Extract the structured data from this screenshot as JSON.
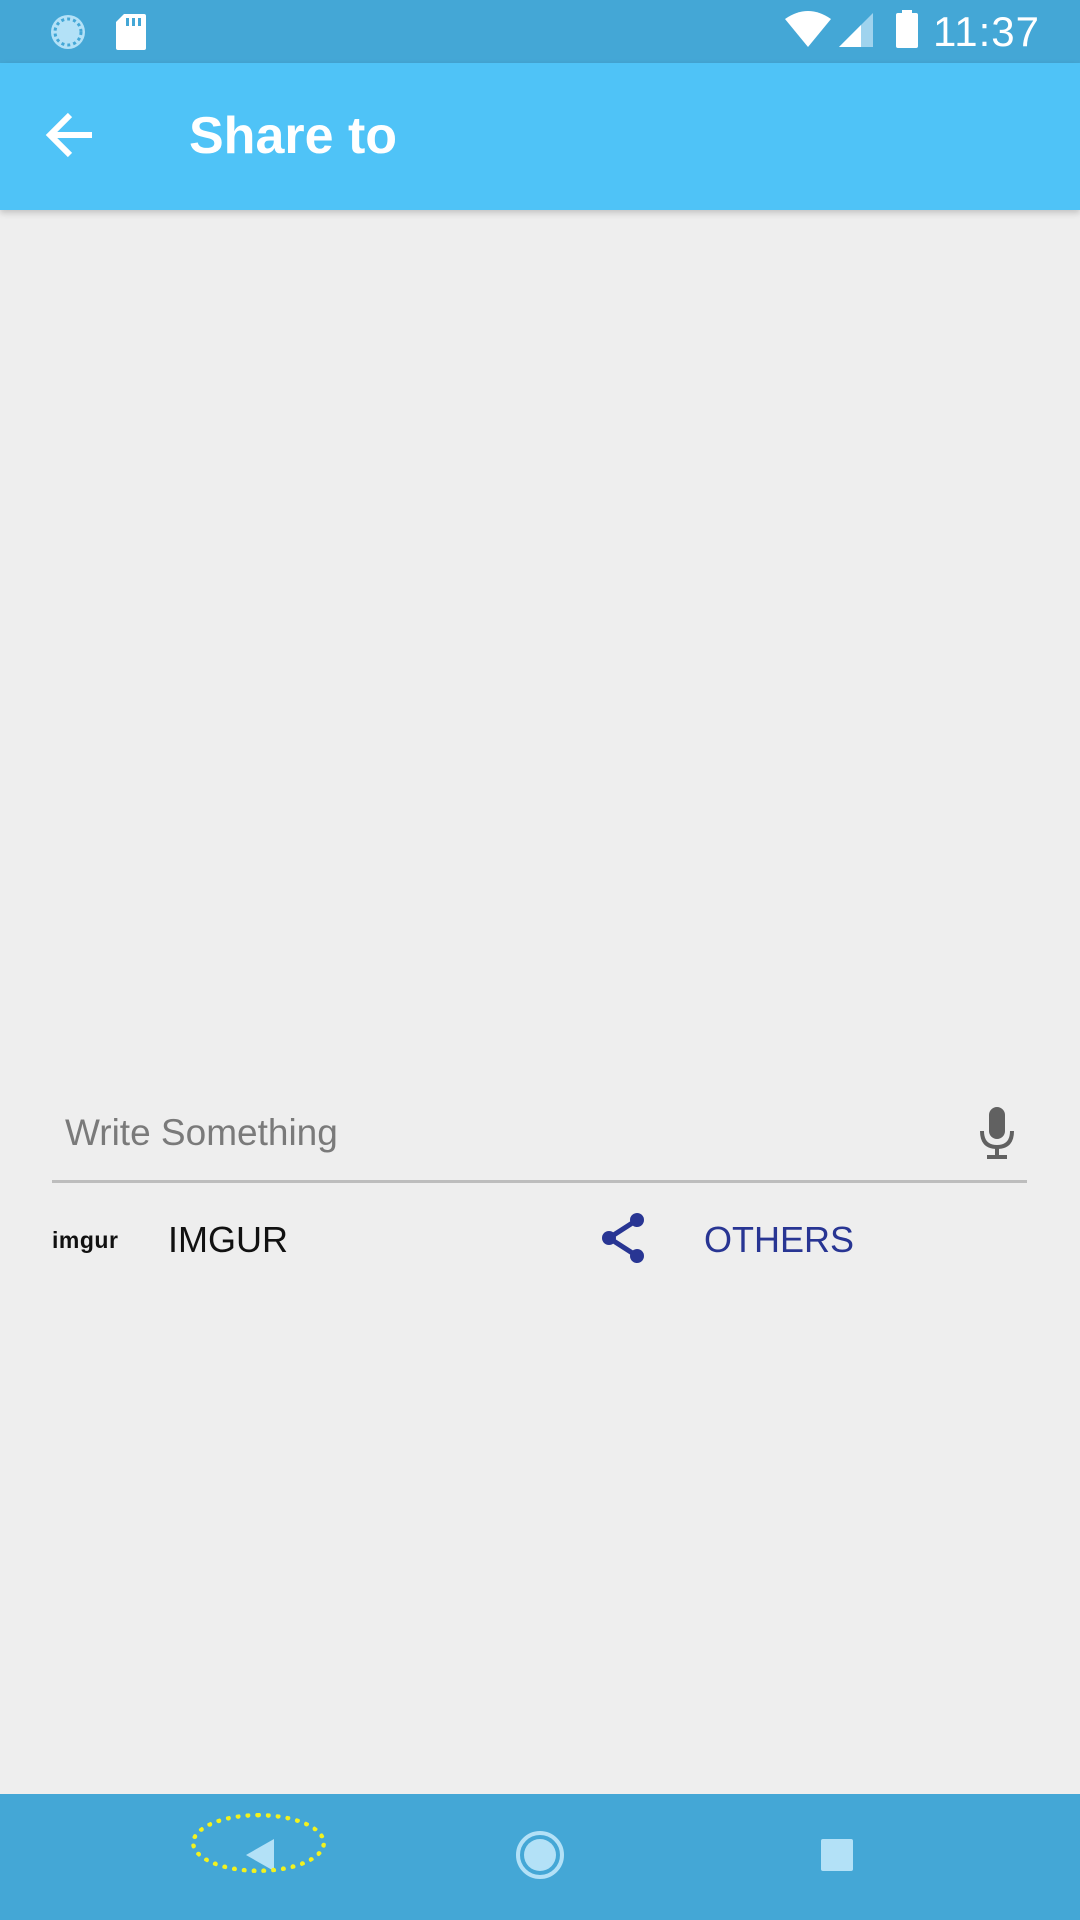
{
  "status_bar": {
    "time": "11:37",
    "left_icons": [
      "sync-icon",
      "sd-card-icon"
    ],
    "right_icons": [
      "wifi-icon",
      "cell-signal-icon",
      "battery-icon"
    ]
  },
  "app_bar": {
    "title": "Share to",
    "back_icon": "arrow-back-icon"
  },
  "compose": {
    "placeholder": "Write Something",
    "value": "",
    "mic_icon": "microphone-icon"
  },
  "share_options": [
    {
      "logo_text": "imgur",
      "label": "IMGUR"
    },
    {
      "icon": "share-icon",
      "label": "OTHERS"
    }
  ],
  "nav_bar": {
    "buttons": [
      "back-triangle-icon",
      "home-circle-icon",
      "recents-square-icon"
    ]
  },
  "colors": {
    "status_bar": "#44a7d6",
    "app_bar": "#4fc3f7",
    "background": "#eeeeee",
    "others_accent": "#283593",
    "highlight": "#f2f21e"
  }
}
